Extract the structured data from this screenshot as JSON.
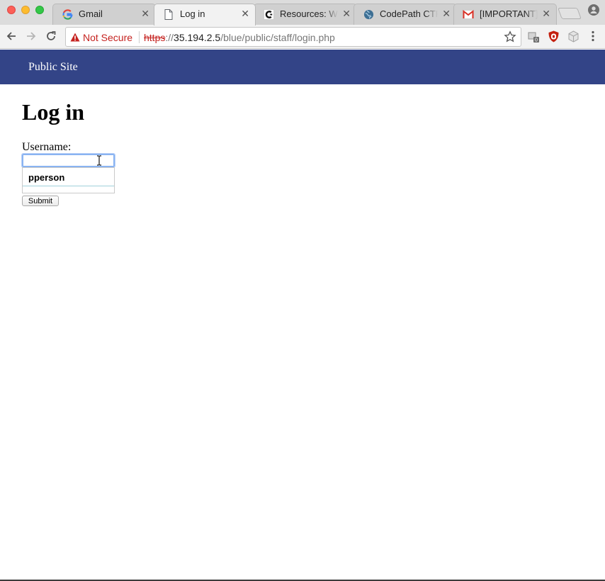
{
  "tabs": [
    {
      "title": "Gmail",
      "favicon": "google-icon",
      "active": false
    },
    {
      "title": "Log in",
      "favicon": "page-icon",
      "active": true
    },
    {
      "title": "Resources: Web",
      "favicon": "codepath-icon",
      "active": false
    },
    {
      "title": "CodePath CTF",
      "favicon": "globe-icon",
      "active": false
    },
    {
      "title": "[IMPORTANT] C",
      "favicon": "gmail-icon",
      "active": false
    }
  ],
  "toolbar": {
    "security_label": "Not Secure",
    "url_scheme": "https",
    "url_separator": "://",
    "url_host": "35.194.2.5",
    "url_path": "/blue/public/staff/login.php",
    "extension_badge": "0"
  },
  "site": {
    "header_link": "Public Site",
    "header_color": "#334487"
  },
  "page": {
    "title": "Log in",
    "username_label": "Username:",
    "username_value": "",
    "autocomplete_suggestion": "pperson",
    "submit_label": "Submit"
  },
  "colors": {
    "not_secure": "#c5221f",
    "focus_ring": "#8ab4f2"
  }
}
